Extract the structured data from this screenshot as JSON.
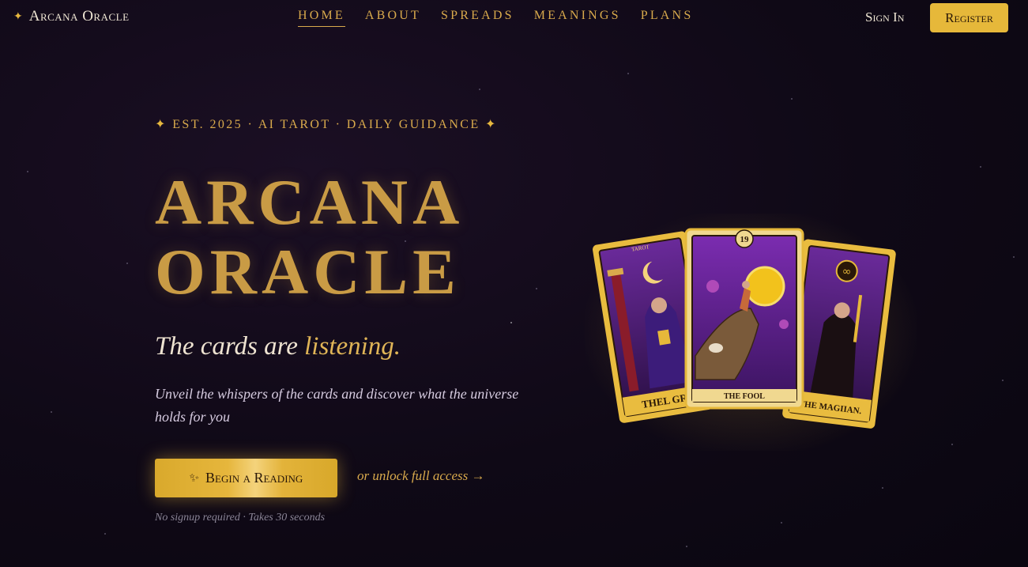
{
  "brand": {
    "icon": "sparkle-icon",
    "name": "Arcana Oracle"
  },
  "nav": {
    "links": [
      {
        "label": "HOME",
        "active": true
      },
      {
        "label": "ABOUT",
        "active": false
      },
      {
        "label": "SPREADS",
        "active": false
      },
      {
        "label": "MEANINGS",
        "active": false
      },
      {
        "label": "PLANS",
        "active": false
      }
    ],
    "signin_label": "Sign In",
    "register_label": "Register"
  },
  "hero": {
    "eyebrow_star": "✦",
    "eyebrow_text": "EST. 2025 · AI TAROT · DAILY GUIDANCE",
    "title_line1": "ARCANA",
    "title_line2": "ORACLE",
    "tagline_main": "The cards are ",
    "tagline_accent": "listening.",
    "description": "Unveil the whispers of the cards and discover what the universe holds for you",
    "cta_icon": "sparkles-icon",
    "cta_label": "Begin a Reading",
    "unlock_label": "or unlock full access →",
    "note": "No signup required · Takes 30 seconds"
  },
  "cards": {
    "left": {
      "top_label": "TAROT",
      "name": "THEL GR"
    },
    "center": {
      "number": "19",
      "name": "THE FOOL"
    },
    "right": {
      "name": "THE MAGIIAN."
    }
  },
  "colors": {
    "accent_gold": "#e6b83a",
    "text_gold": "#d9aa4c",
    "background": "#0f0916"
  }
}
